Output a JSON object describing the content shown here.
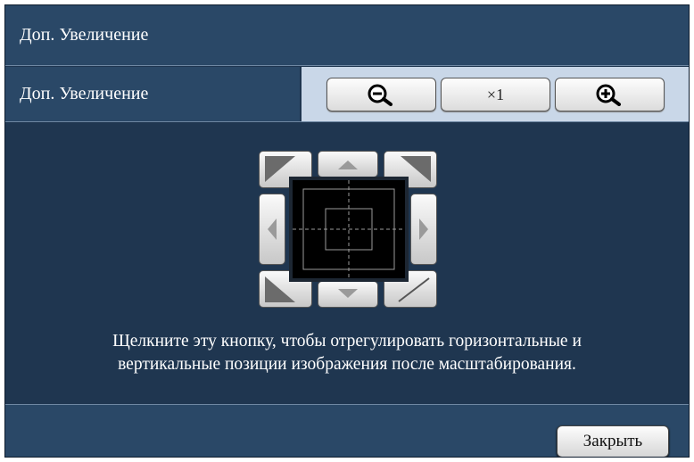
{
  "dialog": {
    "title": "Доп. Увеличение",
    "zoom_row": {
      "label": "Доп. Увеличение",
      "zoom_out_icon": "zoom-out-magnifier-icon",
      "reset_label": "×1",
      "zoom_in_icon": "zoom-in-magnifier-icon"
    },
    "pan_pad": {
      "buttons": [
        "up-left",
        "up",
        "up-right",
        "left",
        "right",
        "down-left",
        "down",
        "down-right"
      ],
      "viewer": "zoom-area-preview"
    },
    "instructions": [
      "Щелкните эту кнопку, чтобы отрегулировать горизонтальные и",
      "вертикальные позиции изображения после масштабирования."
    ],
    "close_label": "Закрыть"
  },
  "colors": {
    "panel": "#1f3650",
    "header": "#2a4867",
    "zoom_controls_bg": "#c9d7e8"
  }
}
